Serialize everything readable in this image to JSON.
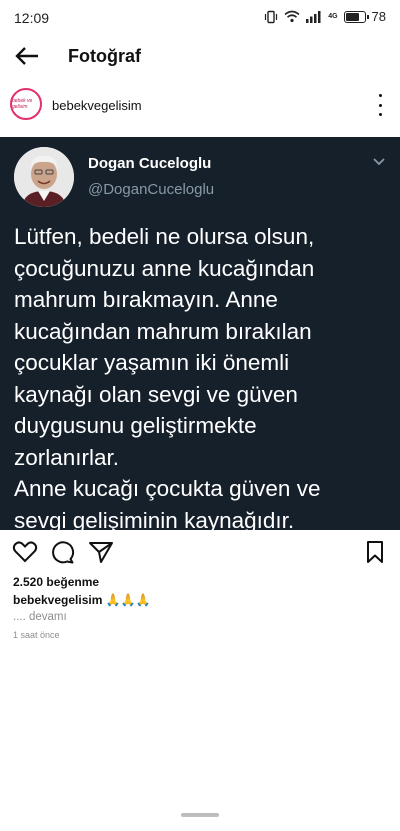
{
  "status_bar": {
    "time": "12:09",
    "network": "4G",
    "battery": "78"
  },
  "header": {
    "title": "Fotoğraf"
  },
  "post": {
    "username": "bebekvegelisim",
    "avatar_text": "bebek ve gelisim"
  },
  "tweet": {
    "name": "Dogan Cuceloglu",
    "handle": "@DoganCuceloglu",
    "lines": [
      "Lütfen, bedeli ne olursa olsun,",
      "çocuğunuzu anne kucağından",
      "mahrum bırakmayın. Anne",
      "kucağından mahrum bırakılan",
      "çocuklar yaşamın iki önemli",
      "kaynağı olan sevgi ve güven",
      "duygusunu geliştirmekte",
      "zorlanırlar.",
      "Anne kucağı çocukta güven ve",
      "sevgi gelişiminin kaynağıdır."
    ]
  },
  "likes": "2.520 beğenme",
  "caption": {
    "user": "bebekvegelisim",
    "text": "🙏🙏🙏"
  },
  "more": ".... devamı",
  "time_ago": "1 saat önce",
  "colors": {
    "tweet_bg": "#15202b",
    "handle": "#8899a6",
    "avatar_ring": "#e1306c"
  }
}
